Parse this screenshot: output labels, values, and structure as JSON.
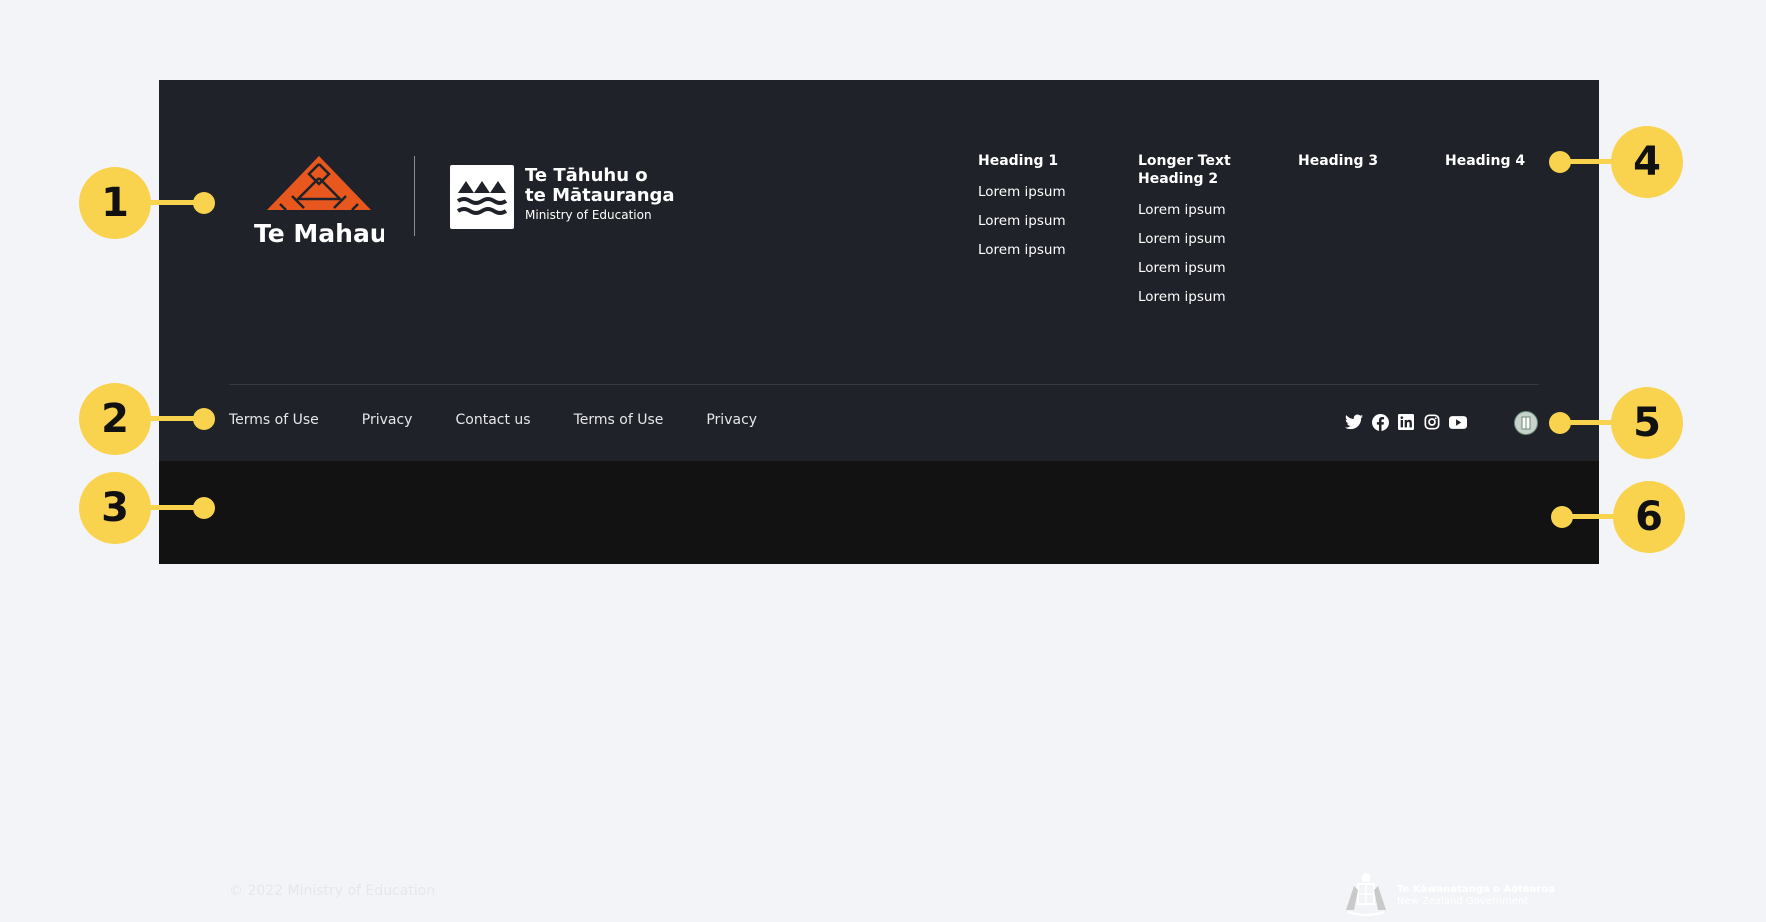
{
  "brand": {
    "te_mahau": "Te Mahau",
    "moe_line1": "Te Tāhuhu o",
    "moe_line2": "te Mātauranga",
    "moe_sub": "Ministry of Education"
  },
  "nav": [
    {
      "heading": "Heading 1",
      "links": [
        "Lorem ipsum",
        "Lorem ipsum",
        "Lorem ipsum"
      ]
    },
    {
      "heading": "Longer Text Heading 2",
      "links": [
        "Lorem ipsum",
        "Lorem ipsum",
        "Lorem ipsum",
        "Lorem ipsum"
      ]
    },
    {
      "heading": "Heading 3",
      "links": []
    },
    {
      "heading": "Heading 4",
      "links": []
    }
  ],
  "legal_links": [
    "Terms of Use",
    "Privacy",
    "Contact us",
    "Terms of Use",
    "Privacy"
  ],
  "socials": [
    "twitter-icon",
    "facebook-icon",
    "linkedin-icon",
    "instagram-icon",
    "youtube-icon"
  ],
  "copyright": "© 2022 Ministry of Education",
  "nzgov": {
    "line1": "Te Kāwanatanga o Aotearoa",
    "line2": "New Zealand Government"
  },
  "callouts": [
    "1",
    "2",
    "3",
    "4",
    "5",
    "6"
  ],
  "colors": {
    "footer": "#1f2229",
    "strip": "#121212",
    "accent": "#f9d24e",
    "maori_orange": "#e8581e"
  }
}
